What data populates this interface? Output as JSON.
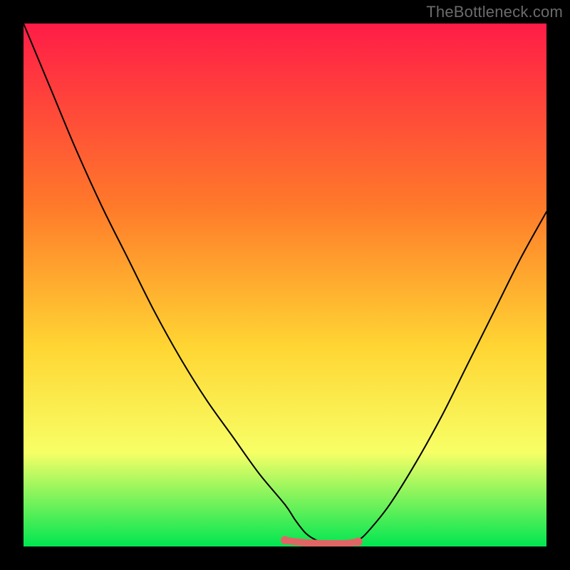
{
  "watermark": "TheBottleneck.com",
  "colors": {
    "background": "#000000",
    "gradient_top": "#ff1c47",
    "gradient_mid1": "#ff7a2a",
    "gradient_mid2": "#ffd633",
    "gradient_mid3": "#f7ff66",
    "gradient_bottom": "#00e651",
    "curve": "#000000",
    "marker_fill": "#e06666",
    "marker_stroke": "#c14d4d"
  },
  "chart_data": {
    "type": "line",
    "title": "",
    "xlabel": "",
    "ylabel": "",
    "xlim": [
      0,
      100
    ],
    "ylim": [
      0,
      100
    ],
    "series": [
      {
        "name": "curve",
        "x": [
          0,
          5,
          10,
          15,
          20,
          25,
          30,
          35,
          40,
          45,
          50,
          52,
          54,
          56,
          58,
          60,
          62,
          64,
          66,
          70,
          75,
          80,
          85,
          90,
          95,
          100
        ],
        "values": [
          100,
          88,
          76,
          65,
          55,
          45,
          36,
          28,
          21,
          14,
          8,
          5,
          2.5,
          1.2,
          0.7,
          0.5,
          0.6,
          1.2,
          3,
          8,
          16,
          25,
          35,
          45,
          55,
          64
        ]
      },
      {
        "name": "bottom-marker",
        "x": [
          50,
          52,
          54,
          56,
          58,
          60,
          62,
          64
        ],
        "values": [
          1.2,
          0.9,
          0.7,
          0.6,
          0.55,
          0.55,
          0.6,
          0.9
        ]
      }
    ],
    "annotations": []
  }
}
